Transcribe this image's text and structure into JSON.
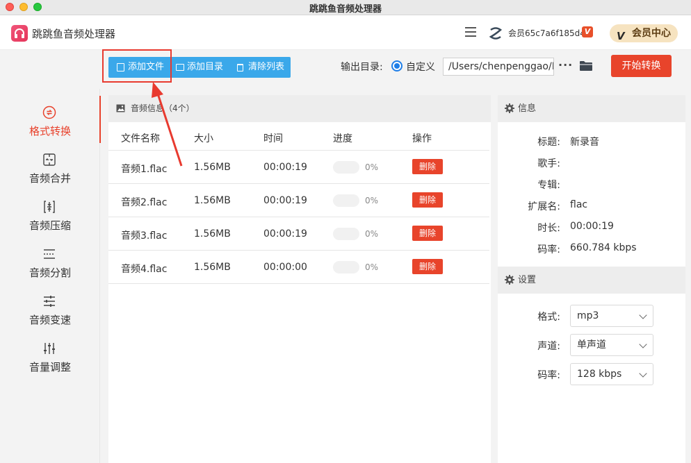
{
  "window": {
    "title": "跳跳鱼音频处理器"
  },
  "header": {
    "app_name": "跳跳鱼音频处理器",
    "user_id": "会员65c7a6f185d4",
    "vip_badge": "V",
    "member_center": "会员中心",
    "member_vmark": "V"
  },
  "sidebar": {
    "items": [
      {
        "label": "格式转换",
        "icon": "convert-icon",
        "active": true
      },
      {
        "label": "音频合并",
        "icon": "merge-icon",
        "active": false
      },
      {
        "label": "音频压缩",
        "icon": "compress-icon",
        "active": false
      },
      {
        "label": "音频分割",
        "icon": "split-icon",
        "active": false
      },
      {
        "label": "音频变速",
        "icon": "speed-icon",
        "active": false
      },
      {
        "label": "音量调整",
        "icon": "volume-icon",
        "active": false
      }
    ]
  },
  "toolbar": {
    "add_file": "添加文件",
    "add_dir": "添加目录",
    "clear_list": "清除列表",
    "output_label": "输出目录:",
    "custom_label": "自定义",
    "output_path": "/Users/chenpenggao/D",
    "more": "···",
    "start": "开始转换"
  },
  "file_list": {
    "title": "音频信息",
    "count": "（4个）",
    "columns": [
      "文件名称",
      "大小",
      "时间",
      "进度",
      "操作"
    ],
    "rows": [
      {
        "name": "音频1.flac",
        "size": "1.56MB",
        "time": "00:00:19",
        "progress": "0%",
        "progress_value": 0,
        "action": "删除"
      },
      {
        "name": "音频2.flac",
        "size": "1.56MB",
        "time": "00:00:19",
        "progress": "0%",
        "progress_value": 0,
        "action": "删除"
      },
      {
        "name": "音频3.flac",
        "size": "1.56MB",
        "time": "00:00:19",
        "progress": "0%",
        "progress_value": 0,
        "action": "删除"
      },
      {
        "name": "音频4.flac",
        "size": "1.56MB",
        "time": "00:00:00",
        "progress": "0%",
        "progress_value": 0,
        "action": "删除"
      }
    ]
  },
  "info": {
    "title": "信息",
    "fields": [
      {
        "key": "标题:",
        "value": "新录音"
      },
      {
        "key": "歌手:",
        "value": ""
      },
      {
        "key": "专辑:",
        "value": ""
      },
      {
        "key": "扩展名:",
        "value": "flac"
      },
      {
        "key": "时长:",
        "value": "00:00:19"
      },
      {
        "key": "码率:",
        "value": "660.784 kbps"
      }
    ]
  },
  "settings": {
    "title": "设置",
    "fields": [
      {
        "key": "格式:",
        "value": "mp3"
      },
      {
        "key": "声道:",
        "value": "单声道"
      },
      {
        "key": "码率:",
        "value": "128 kbps"
      }
    ]
  },
  "colors": {
    "accent_red": "#e8442b",
    "accent_blue": "#3aa8ea",
    "highlight_box": "#e83a2f"
  }
}
